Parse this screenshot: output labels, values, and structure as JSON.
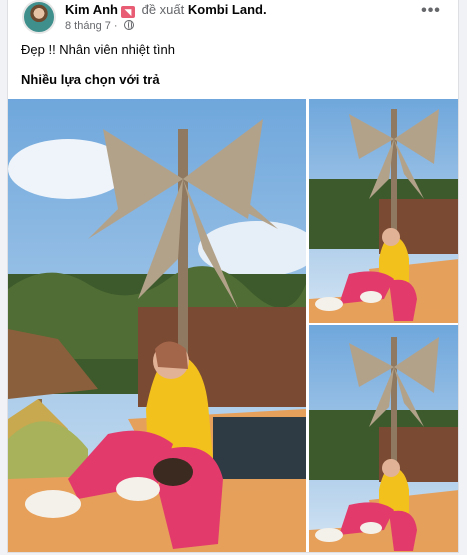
{
  "post": {
    "author": "Kim Anh",
    "recommend_text": "đề xuất",
    "page": "Kombi Land.",
    "date": "8 tháng 7",
    "date_sep": " · ",
    "more_label": "•••",
    "text_line1": "Đẹp !! Nhân viên nhiệt tình",
    "text_line2": "Nhiều lựa chọn với trả"
  },
  "photos": [
    {
      "name": "photo-main"
    },
    {
      "name": "photo-top-right"
    },
    {
      "name": "photo-bottom-right"
    }
  ],
  "colors": {
    "sky": "#7fb4e6",
    "car": "#e8a35a",
    "pants": "#e23b6b",
    "top": "#f3c11c",
    "wall": "#7b4a33",
    "badge": "#e85c74"
  },
  "icons": {
    "badge": "flag-badge-icon",
    "privacy": "globe-icon",
    "more": "more-options-icon"
  }
}
